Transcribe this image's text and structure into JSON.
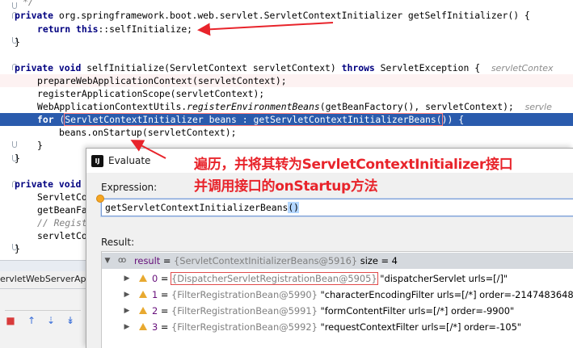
{
  "editor": {
    "lines": {
      "l0": "*/",
      "l1_kw": "private",
      "l1_rest": " org.springframework.boot.web.servlet.ServletContextInitializer getSelfInitializer() {",
      "l2_kw1": "return",
      "l2_kw2": "this",
      "l2_rest": "::selfInitialize;",
      "l3": "}",
      "l5_kw1": "private",
      "l5_kw2": "void",
      "l5_mid": " selfInitialize(ServletContext servletContext) ",
      "l5_kw3": "throws",
      "l5_rest": " ServletException {",
      "l5_hint": "servletContex",
      "l6": "prepareWebApplicationContext(servletContext);",
      "l7": "registerApplicationScope(servletContext);",
      "l8_a": "WebApplicationContextUtils.",
      "l8_b": "registerEnvironmentBeans",
      "l8_c": "(getBeanFactory(), servletContext);",
      "l8_hint": "servle",
      "l9_kw": "for",
      "l9_a": " (",
      "l9_box1": "ServletContextInitializer beans : getServletContextInitializerBeans(",
      "l9_b": ")) {",
      "l10": "beans.onStartup(servletContext);",
      "l11": "}",
      "l12": "}",
      "l14_kw1": "private",
      "l14_kw2": "void",
      "l15": "ServletCo",
      "l16": "getBeanFa",
      "l17": "// Regist",
      "l18": "servletCo",
      "l19": "}"
    }
  },
  "toolwindow": {
    "tab_label": "ervletWebServerAp"
  },
  "dialog": {
    "title": "Evaluate",
    "app_icon_label": "IJ",
    "expression_label": "Expression:",
    "expression_value": "getServletContextInitializerBeans",
    "expression_parens": "()",
    "result_label": "Result:",
    "result": {
      "root": {
        "name": "result",
        "eq": " = ",
        "ref": "{ServletContextInitializerBeans@5916}",
        "size": "  size = 4"
      },
      "items": [
        {
          "index": "0",
          "ref": "{DispatcherServletRegistrationBean@5905}",
          "value": " \"dispatcherServlet urls=[/]\""
        },
        {
          "index": "1",
          "ref": "{FilterRegistrationBean@5990}",
          "value": " \"characterEncodingFilter urls=[/*] order=-2147483648\""
        },
        {
          "index": "2",
          "ref": "{FilterRegistrationBean@5991}",
          "value": " \"formContentFilter urls=[/*] order=-9900\""
        },
        {
          "index": "3",
          "ref": "{FilterRegistrationBean@5992}",
          "value": " \"requestContextFilter urls=[/*] order=-105\""
        }
      ]
    }
  },
  "annotation": {
    "line1": "遍历，并将其转为ServletContextInitializer接口",
    "line2": "并调用接口的onStartup方法"
  },
  "colors": {
    "annotation": "#e8242b",
    "selection": "#2a5bad",
    "keyword": "#000080"
  }
}
